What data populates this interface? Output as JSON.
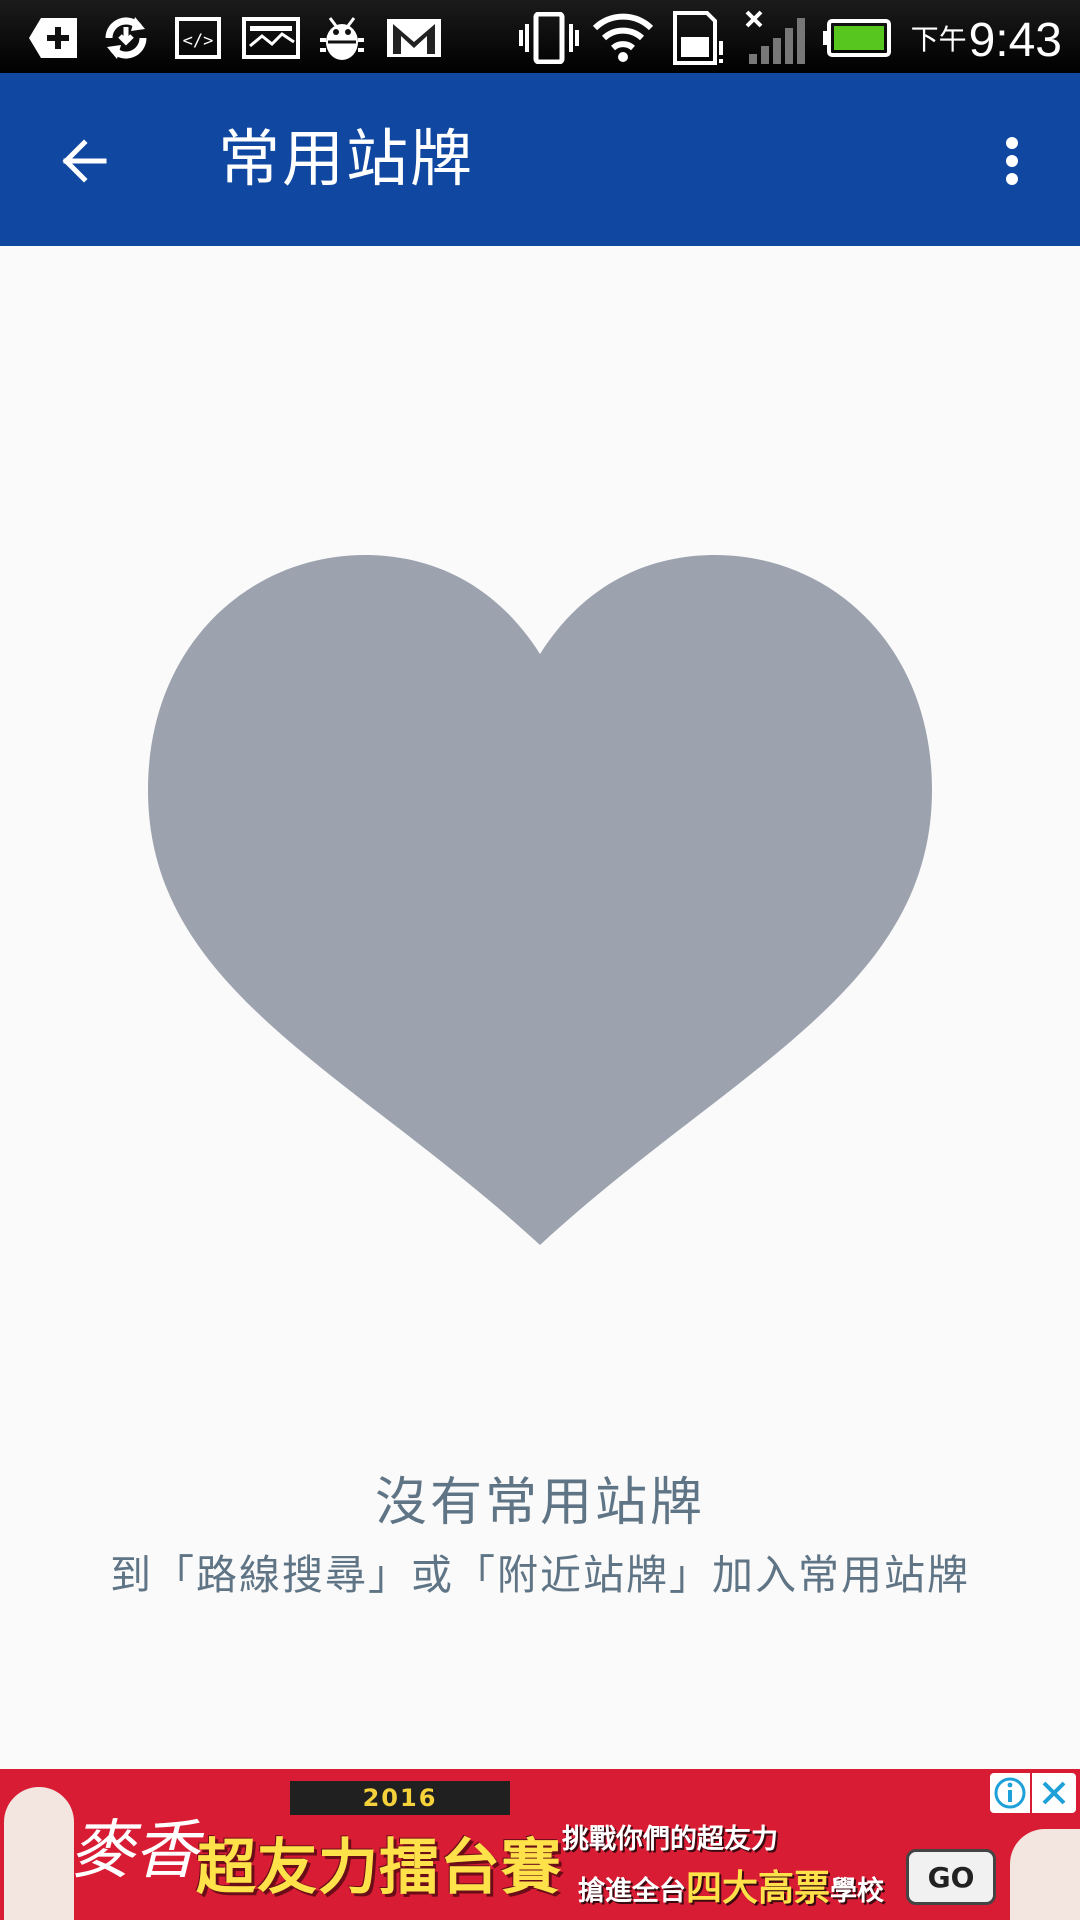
{
  "status_bar": {
    "time_ampm": "下午",
    "time": "9:43",
    "icons": [
      "add-notification-icon",
      "sync-icon",
      "code-icon",
      "image-icon",
      "android-debug-icon",
      "gmail-icon",
      "vibrate-icon",
      "wifi-icon",
      "sd-card-icon",
      "no-signal-icon",
      "battery-icon"
    ]
  },
  "app_bar": {
    "title": "常用站牌",
    "back_icon": "arrow-back-icon",
    "menu_icon": "more-vert-icon",
    "color": "#0f47a1"
  },
  "empty_state": {
    "icon": "heart-icon",
    "icon_color": "#9ca3ae",
    "title": "沒有常用站牌",
    "description": "到「路線搜尋」或「附近站牌」加入常用站牌"
  },
  "ad": {
    "brand": "麥香",
    "year": "2016",
    "headline": "超友力擂台賽",
    "line1": "挑戰你們的超友力",
    "line2_prefix": "搶進全台",
    "line2_highlight": "四大高票",
    "line2_suffix": "學校",
    "go_label": "GO",
    "background": "#d81c34"
  }
}
